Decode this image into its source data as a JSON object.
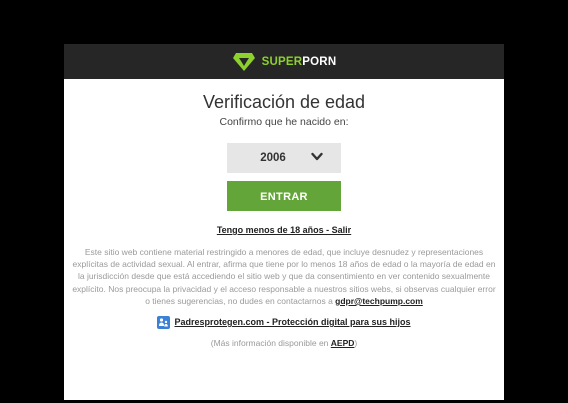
{
  "colors": {
    "page_background": "#000000",
    "header_background": "#262626",
    "brand_green": "#8cd12c",
    "button_green": "#64a53a",
    "select_background": "#e6e6e6",
    "muted_text": "#9a9a9a"
  },
  "header": {
    "logo_icon": "diamond-logo-icon",
    "brand_part1": "SUPER",
    "brand_part2": "PORN"
  },
  "main": {
    "title": "Verificación de edad",
    "subtitle": "Confirmo que he nacido en:",
    "year_select": {
      "value": "2006",
      "icon": "chevron-down-icon"
    },
    "enter_label": "ENTRAR",
    "under18_link": "Tengo menos de 18 años - Salir"
  },
  "disclaimer": {
    "text": "Este sitio web contiene material restringido a menores de edad, que incluye desnudez y representaciones explícitas de actividad sexual. Al entrar, afirma que tiene por lo menos 18 años de edad o la mayoría de edad en la jurisdicción desde que está accediendo el sitio web y que da consentimiento en ver contenido sexualmente explícito. Nos preocupa la privacidad y el acceso responsable a nuestros sitios webs, si observas cualquier error o tienes sugerencias, no dudes en contactarnos a ",
    "email": "gdpr@techpump.com"
  },
  "footer": {
    "parental_icon": "parental-control-icon",
    "parental_link": "Padresprotegen.com - Protección digital para sus hijos",
    "aepd_prefix": "(Más información disponible en ",
    "aepd_link": "AEPD",
    "aepd_suffix": ")"
  }
}
